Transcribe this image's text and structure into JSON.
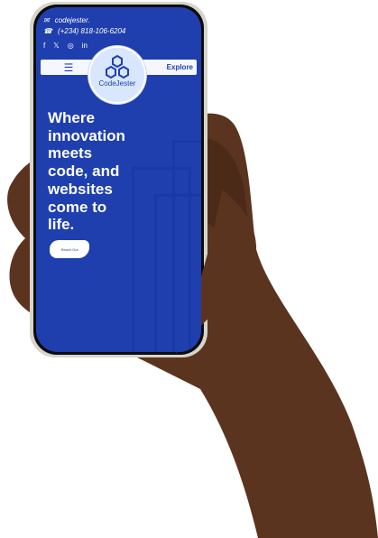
{
  "topbar": {
    "email": "codejester.",
    "phone": "(+234) 818-106-6204"
  },
  "icons": {
    "mail": "mail-icon",
    "phone": "phone-icon",
    "facebook": "facebook-icon",
    "x": "x-icon",
    "instagram": "instagram-icon",
    "linkedin": "linkedin-icon",
    "menu": "hamburger-icon",
    "logo": "hexagons-logo"
  },
  "nav": {
    "explore": "Explore"
  },
  "brand": {
    "name": "CodeJester"
  },
  "hero": {
    "line1": "Where",
    "line2": "innovation",
    "line3": "meets",
    "line4": "code, and",
    "line5": "websites",
    "line6": "come to",
    "line7": "life."
  },
  "cta": {
    "label": "Reach Out"
  },
  "colors": {
    "primary": "#1F3FAE",
    "white": "#FFFFFF",
    "skin": "#5B3420"
  }
}
